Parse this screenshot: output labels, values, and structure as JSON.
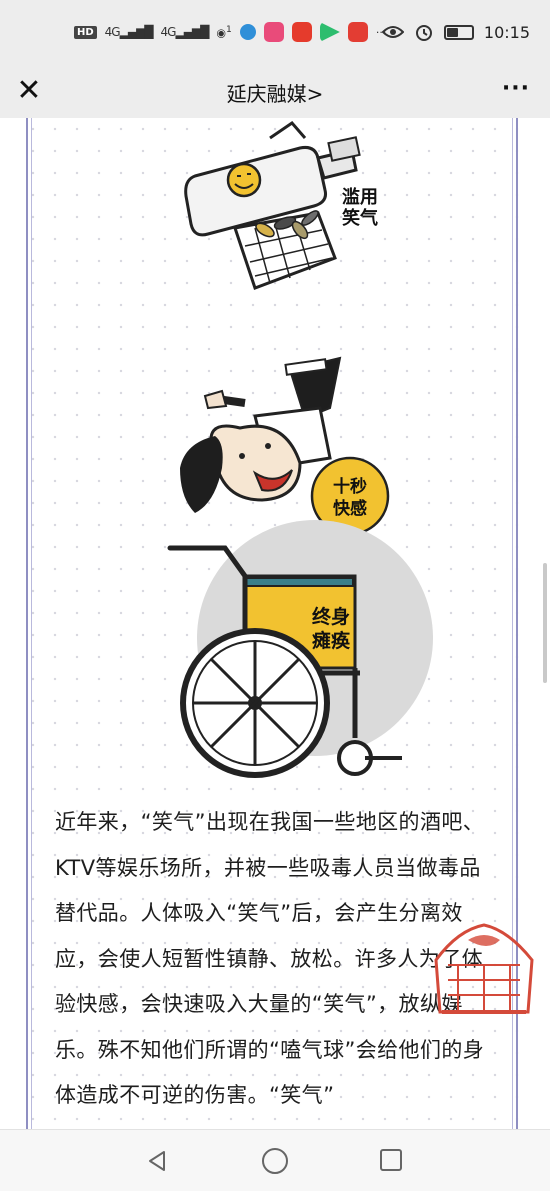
{
  "status_bar": {
    "network_badge": "HD",
    "signal_1": "4G",
    "signal_2": "4G",
    "hotspot_count": "1",
    "time": "10:15",
    "battery_level": 0.45,
    "icons": [
      "hd-icon",
      "signal-icon",
      "signal-icon",
      "hotspot-icon",
      "app-icon",
      "app-icon",
      "app-icon",
      "app-icon",
      "app-icon",
      "more-dots-icon",
      "eye-icon",
      "alarm-icon",
      "battery-icon"
    ],
    "overflow": "···"
  },
  "nav": {
    "close_icon": "close-icon",
    "title": "延庆融媒",
    "title_chevron": ">",
    "more": "···"
  },
  "illustration": {
    "label_1_line1": "滥用",
    "label_1_line2": "笑气",
    "label_2_line1": "十秒",
    "label_2_line2": "快感",
    "label_3_line1": "终身",
    "label_3_line2": "瘫痪",
    "accent_colors": {
      "yellow": "#f2c230",
      "gray": "#dcdcdc",
      "dark": "#222222",
      "teal": "#3a7f8a"
    }
  },
  "article": {
    "paragraph": "近年来，“笑气”出现在我国一些地区的酒吧、KTV等娱乐场所，并被一些吸毒人员当做毒品替代品。人体吸入“笑气”后，会产生分离效应，会使人短暂性镇静、放松。许多人为了体验快感，会快速吸入大量的“笑气”，放纵娱乐。殊不知他们所谓的“嗑气球”会给他们的身体造成不可逆的伤害。“笑气”"
  },
  "seal": {
    "color": "#d44a3a"
  },
  "bottom_nav": {
    "icons": [
      "back-icon",
      "home-icon",
      "recent-apps-icon"
    ]
  }
}
